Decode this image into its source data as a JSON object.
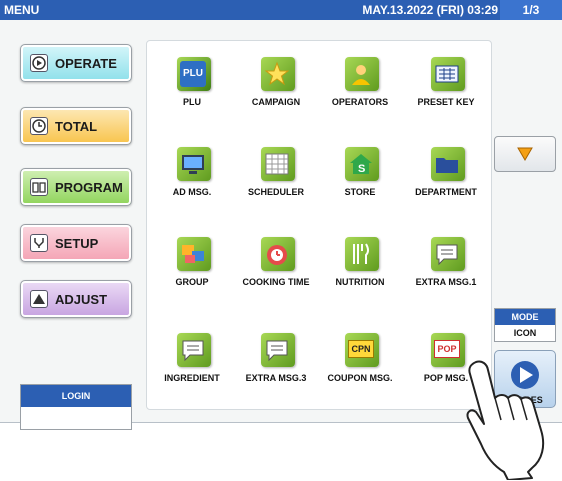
{
  "topbar": {
    "menu": "MENU",
    "datetime": "MAY.13.2022 (FRI)  03:29",
    "page": "1/3"
  },
  "sidebar": {
    "buttons": [
      {
        "label": "OPERATE",
        "color": "#8ee0ea",
        "icon": "play-circle-icon"
      },
      {
        "label": "TOTAL",
        "color": "#f8c34a",
        "icon": "clock-icon"
      },
      {
        "label": "PROGRAM",
        "color": "#8fd45a",
        "icon": "book-icon"
      },
      {
        "label": "SETUP",
        "color": "#f4a3b4",
        "icon": "wrench-icon"
      },
      {
        "label": "ADJUST",
        "color": "#c6a2e0",
        "icon": "adjust-icon"
      }
    ]
  },
  "menu_icons": [
    {
      "label": "PLU",
      "icon": "plu-icon"
    },
    {
      "label": "CAMPAIGN",
      "icon": "star-icon"
    },
    {
      "label": "OPERATORS",
      "icon": "operator-icon"
    },
    {
      "label": "PRESET KEY",
      "icon": "keyboard-icon"
    },
    {
      "label": "AD MSG.",
      "icon": "monitor-icon"
    },
    {
      "label": "SCHEDULER",
      "icon": "calendar-icon"
    },
    {
      "label": "STORE",
      "icon": "store-icon"
    },
    {
      "label": "DEPARTMENT",
      "icon": "folder-icon"
    },
    {
      "label": "GROUP",
      "icon": "group-icon"
    },
    {
      "label": "COOKING TIME",
      "icon": "timer-icon"
    },
    {
      "label": "NUTRITION",
      "icon": "cutlery-icon"
    },
    {
      "label": "EXTRA MSG.1",
      "icon": "message-icon"
    },
    {
      "label": "INGREDIENT",
      "icon": "message-icon"
    },
    {
      "label": "EXTRA MSG.3",
      "icon": "message-icon"
    },
    {
      "label": "COUPON MSG.",
      "icon": "coupon-icon"
    },
    {
      "label": "POP MSG.",
      "icon": "pop-icon"
    }
  ],
  "plu_badge": "PLU",
  "cpn_badge": "CPN",
  "pop_badge": "POP",
  "right": {
    "scroll_icon": "triangle-down-icon",
    "mode_title": "MODE",
    "mode_value": "ICON",
    "images_label": "IMAGES"
  },
  "login": {
    "label": "LOGIN"
  }
}
